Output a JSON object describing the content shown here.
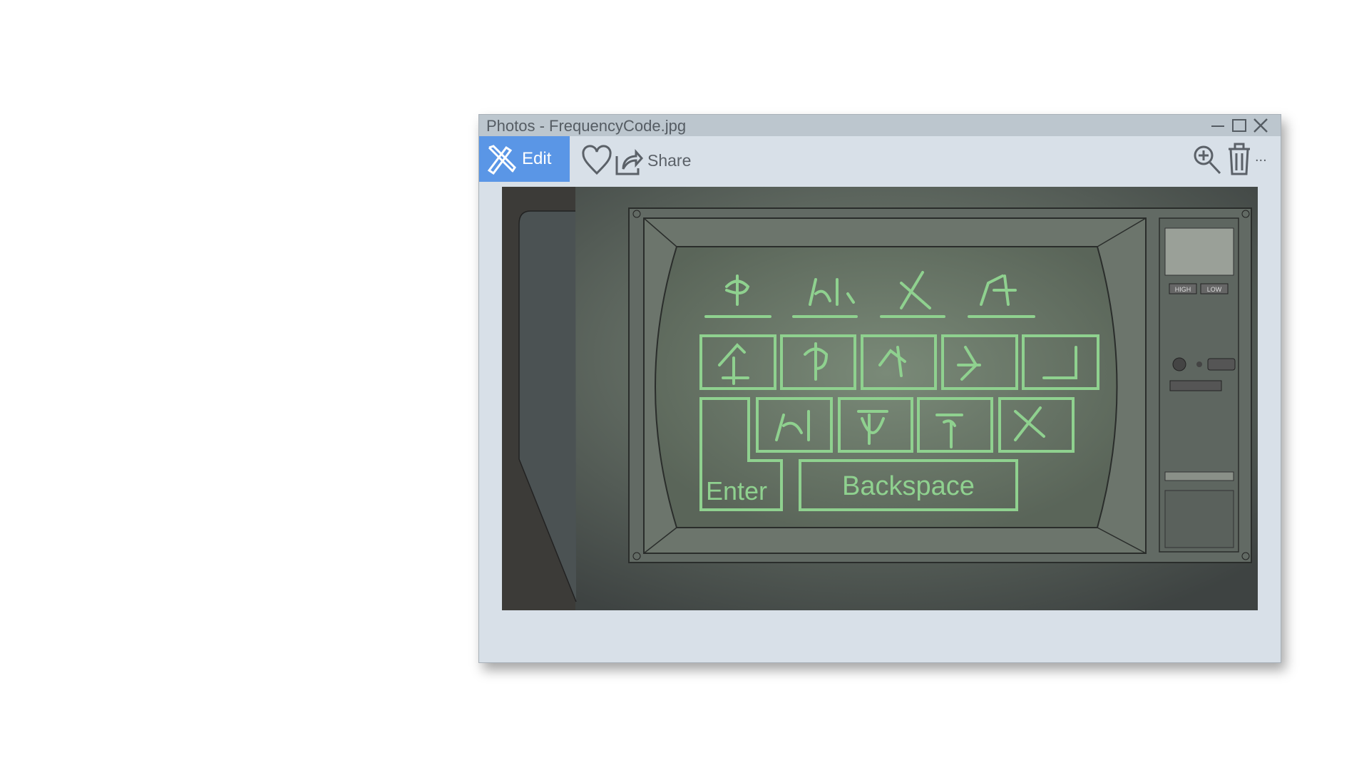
{
  "window": {
    "title": "Photos - FrequencyCode.jpg"
  },
  "toolbar": {
    "edit_label": "Edit",
    "share_label": "Share",
    "more_label": "..."
  },
  "photo": {
    "enter_label": "Enter",
    "backspace_label": "Backspace",
    "panel_labels": [
      "HIGH",
      "LOW"
    ]
  },
  "colors": {
    "accent": "#5a96e6",
    "glow": "#8fd18f",
    "titlebar": "#bcc6ce",
    "toolbar": "#d8e0e8"
  }
}
